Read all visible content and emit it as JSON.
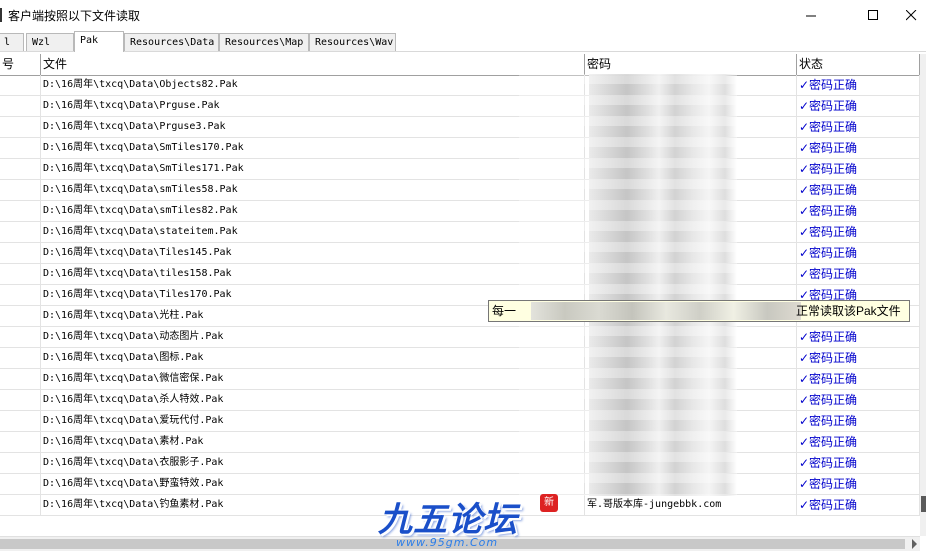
{
  "window": {
    "title": "客户端按照以下文件读取",
    "controls": [
      "minimize-icon",
      "maximize-icon",
      "close-icon"
    ]
  },
  "tabs": [
    {
      "label": "l",
      "active": false
    },
    {
      "label": "Wzl",
      "active": false
    },
    {
      "label": "Pak",
      "active": true
    },
    {
      "label": "Resources\\Data",
      "active": false
    },
    {
      "label": "Resources\\Map",
      "active": false
    },
    {
      "label": "Resources\\Wav",
      "active": false
    }
  ],
  "table": {
    "columns": [
      "号",
      "文件",
      "密码",
      "状态"
    ],
    "rows": [
      {
        "file": "D:\\16周年\\txcq\\Data\\Objects82.Pak",
        "password": "",
        "status": "✓密码正确"
      },
      {
        "file": "D:\\16周年\\txcq\\Data\\Prguse.Pak",
        "password": "",
        "status": "✓密码正确"
      },
      {
        "file": "D:\\16周年\\txcq\\Data\\Prguse3.Pak",
        "password": "",
        "status": "✓密码正确"
      },
      {
        "file": "D:\\16周年\\txcq\\Data\\SmTiles170.Pak",
        "password": "",
        "status": "✓密码正确"
      },
      {
        "file": "D:\\16周年\\txcq\\Data\\SmTiles171.Pak",
        "password": "",
        "status": "✓密码正确"
      },
      {
        "file": "D:\\16周年\\txcq\\Data\\smTiles58.Pak",
        "password": "",
        "status": "✓密码正确"
      },
      {
        "file": "D:\\16周年\\txcq\\Data\\smTiles82.Pak",
        "password": "",
        "status": "✓密码正确"
      },
      {
        "file": "D:\\16周年\\txcq\\Data\\stateitem.Pak",
        "password": "",
        "status": "✓密码正确"
      },
      {
        "file": "D:\\16周年\\txcq\\Data\\Tiles145.Pak",
        "password": "",
        "status": "✓密码正确"
      },
      {
        "file": "D:\\16周年\\txcq\\Data\\tiles158.Pak",
        "password": "",
        "status": "✓密码正确"
      },
      {
        "file": "D:\\16周年\\txcq\\Data\\Tiles170.Pak",
        "password": "",
        "status": "✓密码正确"
      },
      {
        "file": "D:\\16周年\\txcq\\Data\\光柱.Pak",
        "password": "",
        "status": "✓密码正确"
      },
      {
        "file": "D:\\16周年\\txcq\\Data\\动态图片.Pak",
        "password": "",
        "status": "✓密码正确"
      },
      {
        "file": "D:\\16周年\\txcq\\Data\\图标.Pak",
        "password": "",
        "status": "✓密码正确"
      },
      {
        "file": "D:\\16周年\\txcq\\Data\\微信密保.Pak",
        "password": "",
        "status": "✓密码正确"
      },
      {
        "file": "D:\\16周年\\txcq\\Data\\杀人特效.Pak",
        "password": "",
        "status": "✓密码正确"
      },
      {
        "file": "D:\\16周年\\txcq\\Data\\爱玩代付.Pak",
        "password": "",
        "status": "✓密码正确"
      },
      {
        "file": "D:\\16周年\\txcq\\Data\\素材.Pak",
        "password": "",
        "status": "✓密码正确"
      },
      {
        "file": "D:\\16周年\\txcq\\Data\\衣服影子.Pak",
        "password": "",
        "status": "✓密码正确"
      },
      {
        "file": "D:\\16周年\\txcq\\Data\\野蛮特效.Pak",
        "password": "",
        "status": "✓密码正确"
      },
      {
        "file": "D:\\16周年\\txcq\\Data\\钓鱼素材.Pak",
        "password": "军.哥版本库-jungebbk.com",
        "status": "✓密码正确"
      }
    ]
  },
  "tooltip": {
    "left_text": "每一",
    "right_text": "正常读取该Pak文件"
  },
  "watermark": {
    "logo_text": "九五论坛",
    "seal_text": "新",
    "url": "www.95gm.Com"
  }
}
